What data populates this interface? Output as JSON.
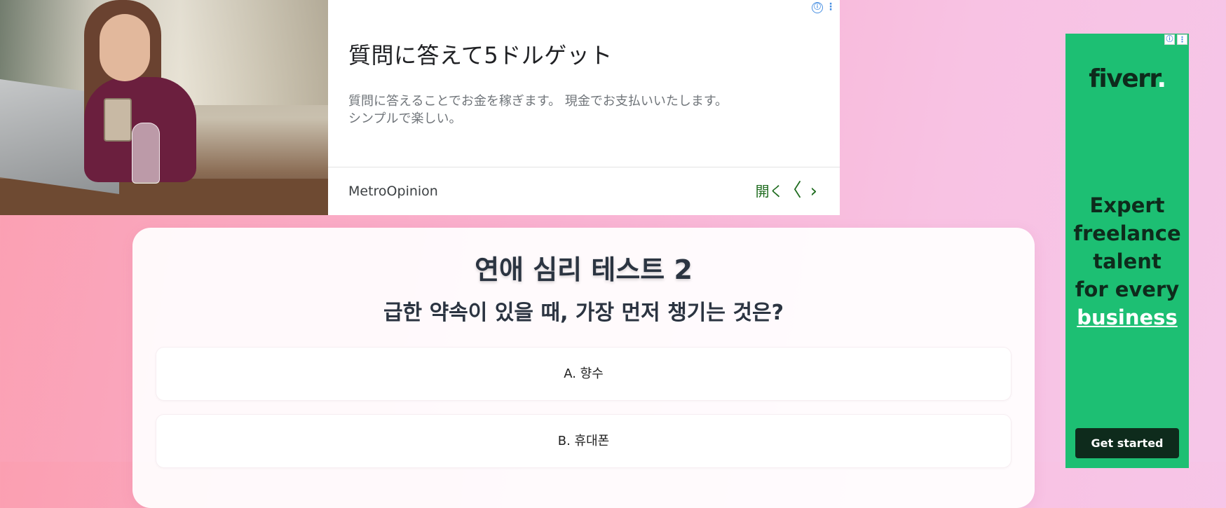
{
  "top_ad": {
    "headline": "質問に答えて5ドルゲット",
    "description_line1": "質問に答えることでお金を稼ぎます。 現金でお支払いいたします。",
    "description_line2": "シンプルで楽しい。",
    "brand": "MetroOpinion",
    "cta_label": "開く",
    "info_icon_glyph": "ⓘ",
    "more_icon_glyph": "⋮",
    "back_glyph": "〈",
    "forward_glyph": "›",
    "accent_color": "#1e6b1e"
  },
  "quiz": {
    "title": "연애 심리 테스트 2",
    "question": "급한 약속이 있을 때, 가장 먼저 챙기는 것은?",
    "options": [
      {
        "label": "A. 향수"
      },
      {
        "label": "B. 휴대폰"
      }
    ]
  },
  "side_ad": {
    "logo_text": "fiverr",
    "logo_dot": ".",
    "tagline_lines": [
      "Expert",
      "freelance",
      "talent",
      "for every"
    ],
    "tagline_highlight": "business",
    "cta_label": "Get started",
    "info_icon_glyph": "ⓘ",
    "more_icon_glyph": "⋮",
    "brand_color": "#1dbf73"
  }
}
